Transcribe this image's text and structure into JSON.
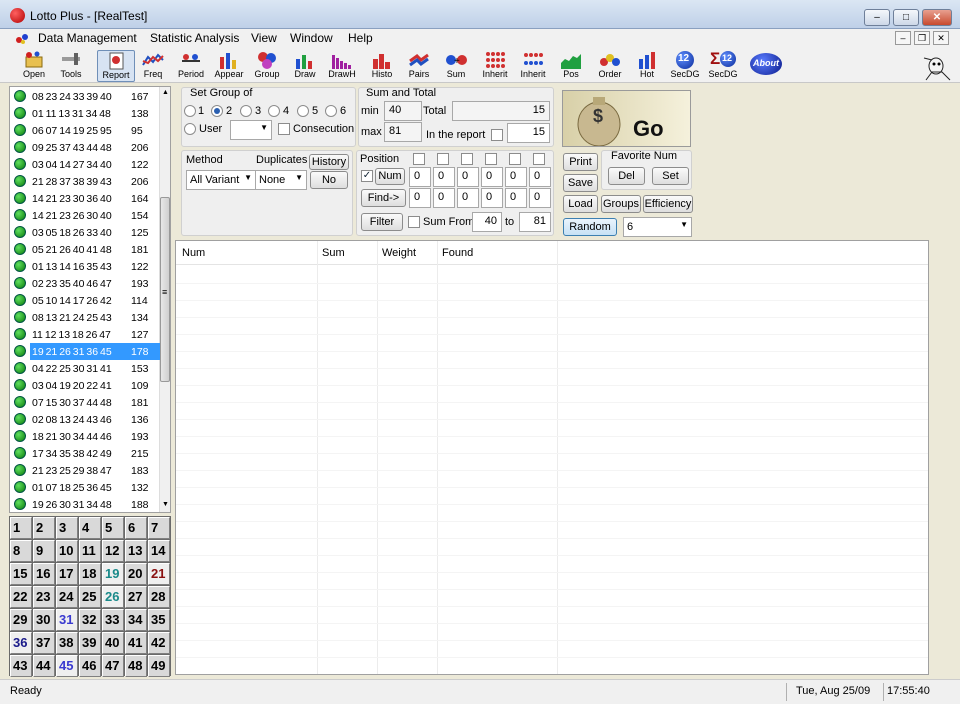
{
  "window": {
    "title": "Lotto Plus - [RealTest]",
    "minimize": "–",
    "maximize": "□",
    "close": "✕"
  },
  "menu": {
    "items": [
      "Data Management",
      "Statistic Analysis",
      "View",
      "Window",
      "Help"
    ],
    "mdi_min": "–",
    "mdi_restore": "❐",
    "mdi_close": "✕"
  },
  "toolbar": {
    "items": [
      "Open",
      "Tools",
      "Report",
      "Freq",
      "Period",
      "Appear",
      "Group",
      "Draw",
      "DrawH",
      "Histo",
      "Pairs",
      "Sum",
      "Inherit",
      "Inherit",
      "Pos",
      "Order",
      "Hot",
      "SecDG",
      "SecDG",
      "About"
    ],
    "active": "Report",
    "about_label": "About",
    "secdg_badge": "12",
    "sigma": "Σ"
  },
  "draws": [
    {
      "nums": "08 23 24 33 39 40",
      "count": "167"
    },
    {
      "nums": "01 11 13 31 34 48",
      "count": "138"
    },
    {
      "nums": "06 07 14 19 25 95",
      "count": "95"
    },
    {
      "nums": "09 25 37 43 44 48",
      "count": "206"
    },
    {
      "nums": "03 04 14 27 34 40",
      "count": "122"
    },
    {
      "nums": "21 28 37 38 39 43",
      "count": "206"
    },
    {
      "nums": "14 21 23 30 36 40",
      "count": "164"
    },
    {
      "nums": "14 21 23 26 30 40",
      "count": "154"
    },
    {
      "nums": "03 05 18 26 33 40",
      "count": "125"
    },
    {
      "nums": "05 21 26 40 41 48",
      "count": "181"
    },
    {
      "nums": "01 13 14 16 35 43",
      "count": "122"
    },
    {
      "nums": "02 23 35 40 46 47",
      "count": "193"
    },
    {
      "nums": "05 10 14 17 26 42",
      "count": "114"
    },
    {
      "nums": "08 13 21 24 25 43",
      "count": "134"
    },
    {
      "nums": "11 12 13 18 26 47",
      "count": "127"
    },
    {
      "nums": "19 21 26 31 36 45",
      "count": "178"
    },
    {
      "nums": "04 22 25 30 31 41",
      "count": "153"
    },
    {
      "nums": "03 04 19 20 22 41",
      "count": "109"
    },
    {
      "nums": "07 15 30 37 44 48",
      "count": "181"
    },
    {
      "nums": "02 08 13 24 43 46",
      "count": "136"
    },
    {
      "nums": "18 21 30 34 44 46",
      "count": "193"
    },
    {
      "nums": "17 34 35 38 42 49",
      "count": "215"
    },
    {
      "nums": "21 23 25 29 38 47",
      "count": "183"
    },
    {
      "nums": "01 07 18 25 36 45",
      "count": "132"
    },
    {
      "nums": "19 26 30 31 34 48",
      "count": "188"
    }
  ],
  "selected_draw_index": 15,
  "number_grid": {
    "numbers": [
      "1",
      "2",
      "3",
      "4",
      "5",
      "6",
      "7",
      "8",
      "9",
      "10",
      "11",
      "12",
      "13",
      "14",
      "15",
      "16",
      "17",
      "18",
      "19",
      "20",
      "21",
      "22",
      "23",
      "24",
      "25",
      "26",
      "27",
      "28",
      "29",
      "30",
      "31",
      "32",
      "33",
      "34",
      "35",
      "36",
      "37",
      "38",
      "39",
      "40",
      "41",
      "42",
      "43",
      "44",
      "45",
      "46",
      "47",
      "48",
      "49"
    ],
    "highlighted": {
      "19": "#1a8a8a",
      "21": "#8a1010",
      "26": "#1a8a8a",
      "31": "#3a3ad0",
      "36": "#1a1a8a",
      "45": "#3a3ad0"
    }
  },
  "set_group": {
    "title": "Set Group of",
    "options": [
      "1",
      "2",
      "3",
      "4",
      "5",
      "6"
    ],
    "selected": "2",
    "user_label": "User",
    "user_value": "",
    "consecution_label": "Consecution"
  },
  "sum_total": {
    "title": "Sum and Total",
    "min_label": "min",
    "min_value": "40",
    "max_label": "max",
    "max_value": "81",
    "total_label": "Total",
    "total_value": "15",
    "in_report_label": "In the report",
    "in_report_value": "15"
  },
  "go_label": "Go",
  "go_symbol": "$",
  "method": {
    "label": "Method",
    "value": "All Variant",
    "duplicates_label": "Duplicates",
    "duplicates_value": "None",
    "history_label": "History",
    "no_label": "No"
  },
  "position": {
    "label": "Position",
    "num_label": "Num",
    "num_checked": "✓",
    "find_label": "Find->",
    "row1": [
      "0",
      "0",
      "0",
      "0",
      "0",
      "0"
    ],
    "row2": [
      "0",
      "0",
      "0",
      "0",
      "0",
      "0"
    ],
    "filter_label": "Filter",
    "sum_from_label": "Sum From",
    "sum_from": "40",
    "to_label": "to",
    "sum_to": "81"
  },
  "actions": {
    "print": "Print",
    "save": "Save",
    "load": "Load",
    "random": "Random",
    "random_value": "6",
    "favorite_label": "Favorite Num",
    "del": "Del",
    "set": "Set",
    "groups": "Groups",
    "efficiency": "Efficiency"
  },
  "report": {
    "columns": [
      "Num",
      "Sum",
      "Weight",
      "Found"
    ]
  },
  "status": {
    "text": "Ready",
    "date": "Tue, Aug 25/09",
    "time": "17:55:40"
  }
}
